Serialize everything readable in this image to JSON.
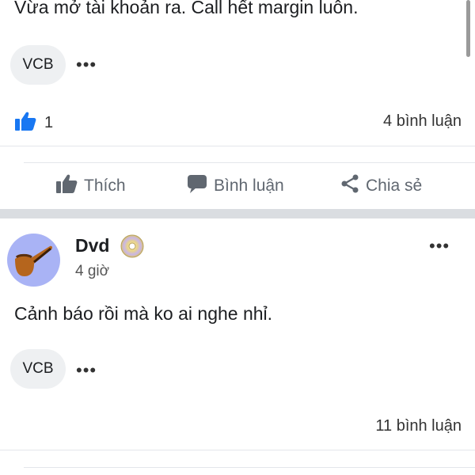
{
  "post1": {
    "text": "Vừa mở tài khoản ra. Call hết margin luôn.",
    "tag": "VCB",
    "more_icon": "more-horizontal-icon",
    "like_count": "1",
    "comments": "4 bình luận"
  },
  "actions": {
    "like": "Thích",
    "comment": "Bình luận",
    "share": "Chia sẻ"
  },
  "post2": {
    "author": "Dvd",
    "time": "4 giờ",
    "text": "Cảnh báo rồi mà ko ai nghe nhỉ.",
    "tag": "VCB",
    "comments": "11 bình luận"
  },
  "colors": {
    "like_blue": "#1877f2",
    "avatar_bg": "#a9b3f5",
    "divider": "#dadde1"
  }
}
